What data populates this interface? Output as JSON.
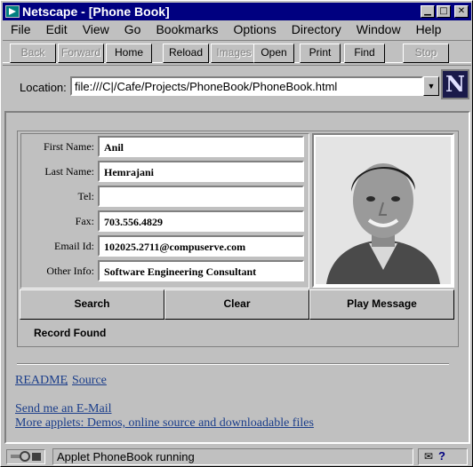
{
  "window": {
    "title": "Netscape - [Phone Book]"
  },
  "titlebar_buttons": {
    "minimize": "▁",
    "maximize": "□",
    "close": "✕"
  },
  "menu": [
    "File",
    "Edit",
    "View",
    "Go",
    "Bookmarks",
    "Options",
    "Directory",
    "Window",
    "Help"
  ],
  "toolbar": {
    "back": "Back",
    "forward": "Forward",
    "home": "Home",
    "reload": "Reload",
    "images": "Images",
    "open": "Open",
    "print": "Print",
    "find": "Find",
    "stop": "Stop"
  },
  "location": {
    "label": "Location:",
    "url": "file:///C|/Cafe/Projects/PhoneBook/PhoneBook.html"
  },
  "logo": {
    "letter": "N"
  },
  "form": {
    "fields": [
      {
        "label": "First Name:",
        "value": "Anil"
      },
      {
        "label": "Last Name:",
        "value": "Hemrajani"
      },
      {
        "label": "Tel:",
        "value": ""
      },
      {
        "label": "Fax:",
        "value": "703.556.4829"
      },
      {
        "label": "Email Id:",
        "value": "102025.2711@compuserve.com"
      },
      {
        "label": "Other Info:",
        "value": "Software Engineering Consultant"
      }
    ]
  },
  "buttons": {
    "search": "Search",
    "clear": "Clear",
    "play": "Play Message"
  },
  "status_message": "Record Found",
  "links": {
    "readme": "README",
    "separator": ",",
    "source": "Source",
    "email": "Send me an E-Mail",
    "more": "More applets: Demos, online source and downloadable files"
  },
  "statusbar": {
    "text": "Applet PhoneBook running"
  },
  "colors": {
    "titlebar": "#000080",
    "link": "#1a3d8a",
    "chrome": "#c0c0c0"
  }
}
